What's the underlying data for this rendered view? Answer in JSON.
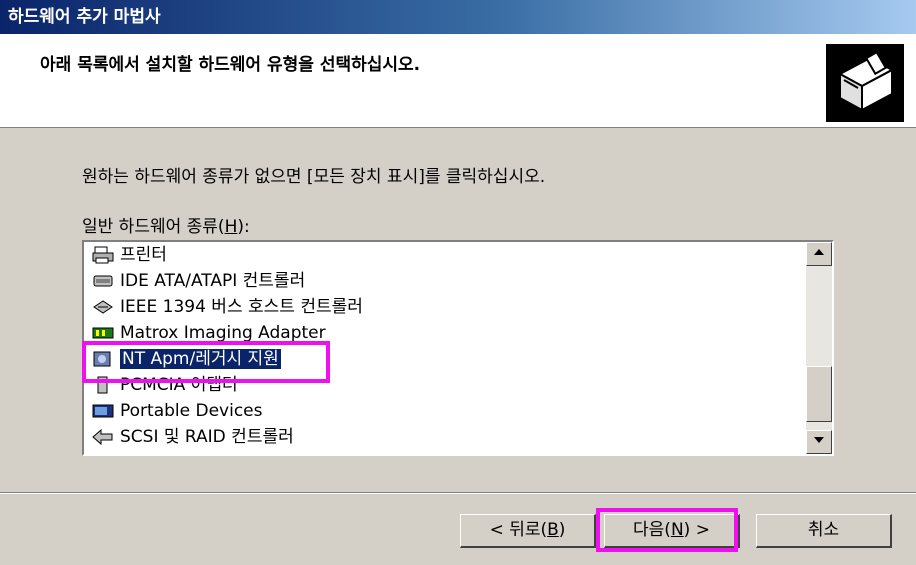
{
  "window": {
    "title": "하드웨어 추가 마법사"
  },
  "header": {
    "title": "아래 목록에서 설치할 하드웨어 유형을 선택하십시오.",
    "icon": "hardware-box-icon"
  },
  "body": {
    "instruction": "원하는 하드웨어 종류가 없으면 [모든 장치 표시]를 클릭하십시오.",
    "list_label_prefix": "일반 하드웨어 종류(",
    "list_label_key": "H",
    "list_label_suffix": "):"
  },
  "list": {
    "items": [
      {
        "label": "프린터",
        "icon": "printer-icon"
      },
      {
        "label": "IDE ATA/ATAPI 컨트롤러",
        "icon": "ide-controller-icon"
      },
      {
        "label": "IEEE 1394 버스 호스트 컨트롤러",
        "icon": "ieee1394-icon"
      },
      {
        "label": "Matrox Imaging Adapter",
        "icon": "imaging-adapter-icon"
      },
      {
        "label": "NT Apm/레거시 지원",
        "icon": "apm-icon",
        "selected": true
      },
      {
        "label": "PCMCIA 어댑터",
        "icon": "pcmcia-icon"
      },
      {
        "label": "Portable Devices",
        "icon": "portable-device-icon"
      },
      {
        "label": "SCSI 및 RAID 컨트롤러",
        "icon": "scsi-icon"
      }
    ],
    "scroll_position": 0.62
  },
  "buttons": {
    "back": {
      "pre": "< 뒤로(",
      "key": "B",
      "post": ")"
    },
    "next": {
      "pre": "다음(",
      "key": "N",
      "post": ") >"
    },
    "cancel": "취소"
  },
  "colors": {
    "title_start": "#0a246a",
    "highlight": "#ee10ee",
    "selection": "#0a246a"
  }
}
